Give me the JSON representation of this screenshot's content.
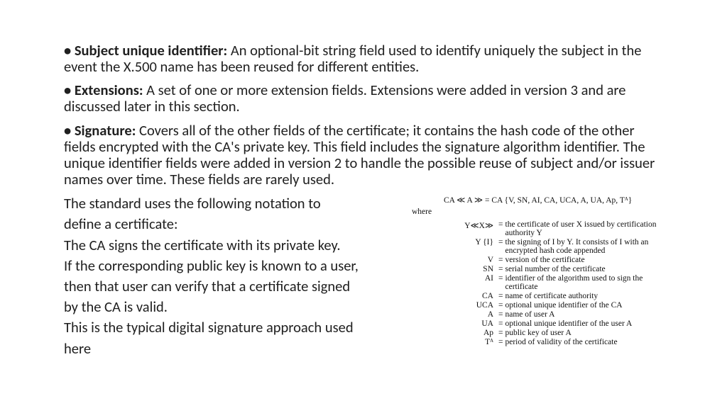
{
  "bullets": [
    {
      "term": "Subject unique identifier:",
      "text": " An optional-bit string field used to identify uniquely the subject in the event the X.500 name has been reused for different entities."
    },
    {
      "term": "Extensions:",
      "text": " A set of one or more extension fields. Extensions were added in version 3 and are discussed later in this section."
    },
    {
      "term": "Signature:",
      "text": " Covers all of the other fields of the certificate; it contains the hash code of the other fields encrypted with the CA's private key. This field includes the signature algorithm identifier. The unique identifier fields were added in version 2 to handle the possible reuse of subject and/or issuer names over time. These fields are rarely used."
    }
  ],
  "left": {
    "l1": " The standard uses the following notation to",
    "l2": "define a certificate:",
    "l3": "The CA signs the certificate with its private key.",
    "l4": "If the corresponding public key is known to a user,",
    "l5": " then that user can verify that a certificate signed",
    "l6": "by the CA is valid.",
    "l7": "This is the typical digital signature approach used",
    "l8": " here"
  },
  "notation": {
    "formula_left": "CA ≪ A ≫ ",
    "formula_right": " CA {V, SN, AI, CA, UCA, A, UA, Ap, Tᴬ}",
    "where": "where",
    "defs": [
      {
        "sym": "Y≪X≫",
        "txt": "the certificate of user X issued by certification authority Y"
      },
      {
        "sym": "Y {I}",
        "txt": "the signing of I by Y. It consists of I with an encrypted hash code appended"
      },
      {
        "sym": "V",
        "txt": "version of the certificate"
      },
      {
        "sym": "SN",
        "txt": "serial number of the certificate"
      },
      {
        "sym": "AI",
        "txt": "identifier of the algorithm used to sign the certificate"
      },
      {
        "sym": "CA",
        "txt": "name of certificate authority"
      },
      {
        "sym": "UCA",
        "txt": "optional unique identifier of the CA"
      },
      {
        "sym": "A",
        "txt": "name of user A"
      },
      {
        "sym": "UA",
        "txt": "optional unique identifier of the user A"
      },
      {
        "sym": "Ap",
        "txt": "public key of user A"
      },
      {
        "sym": "Tᴬ",
        "txt": "period of validity of the certificate"
      }
    ]
  }
}
